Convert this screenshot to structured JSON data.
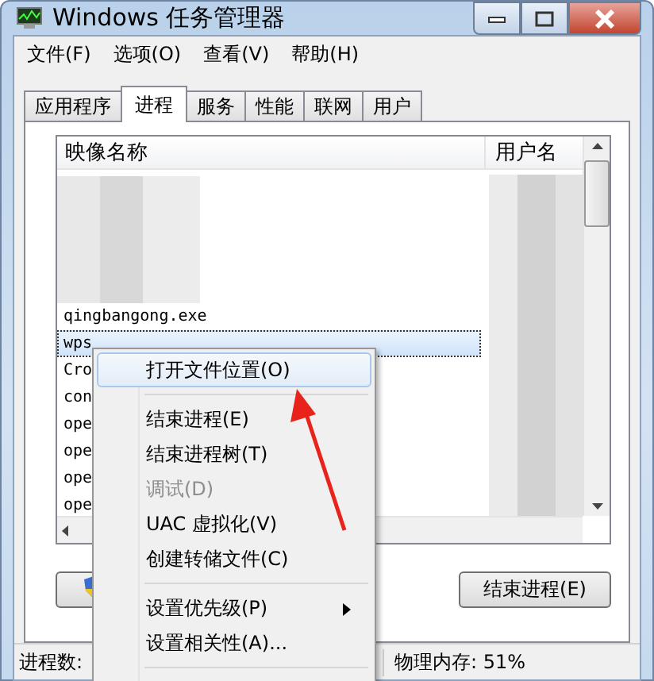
{
  "window": {
    "title": "Windows 任务管理器"
  },
  "menu_bar": [
    "文件(F)",
    "选项(O)",
    "查看(V)",
    "帮助(H)"
  ],
  "tabs": [
    {
      "label": "应用程序",
      "selected": false
    },
    {
      "label": "进程",
      "selected": true
    },
    {
      "label": "服务",
      "selected": false
    },
    {
      "label": "性能",
      "selected": false
    },
    {
      "label": "联网",
      "selected": false
    },
    {
      "label": "用户",
      "selected": false
    }
  ],
  "table": {
    "columns": [
      "映像名称",
      "用户名"
    ],
    "rows": [
      {
        "name": "qingbangong.exe",
        "selected": false
      },
      {
        "name": "wps",
        "selected": true
      },
      {
        "name": "Cro",
        "selected": false
      },
      {
        "name": "con",
        "selected": false
      },
      {
        "name": "ope",
        "selected": false
      },
      {
        "name": "ope",
        "selected": false
      },
      {
        "name": "ope",
        "selected": false
      },
      {
        "name": "ope",
        "selected": false
      }
    ]
  },
  "buttons": [
    {
      "kind": "shield"
    },
    {
      "kind": "plain",
      "label": "结束进程(E)"
    }
  ],
  "status_bar": [
    "进程数:",
    "物理内存: 51%"
  ],
  "context_menu": {
    "items": [
      {
        "kind": "item",
        "label": "打开文件位置(O)",
        "selected": true,
        "disabled": false
      },
      {
        "kind": "separator"
      },
      {
        "kind": "item",
        "label": "结束进程(E)",
        "selected": false,
        "disabled": false
      },
      {
        "kind": "item",
        "label": "结束进程树(T)",
        "selected": false,
        "disabled": false
      },
      {
        "kind": "item",
        "label": "调试(D)",
        "selected": false,
        "disabled": true
      },
      {
        "kind": "item",
        "label": "UAC 虚拟化(V)",
        "selected": false,
        "disabled": false
      },
      {
        "kind": "item",
        "label": "创建转储文件(C)",
        "selected": false,
        "disabled": false
      },
      {
        "kind": "separator"
      },
      {
        "kind": "submenu",
        "label": "设置优先级(P)",
        "selected": false,
        "disabled": false
      },
      {
        "kind": "item",
        "label": "设置相关性(A)...",
        "selected": false,
        "disabled": false
      },
      {
        "kind": "separator"
      }
    ]
  }
}
